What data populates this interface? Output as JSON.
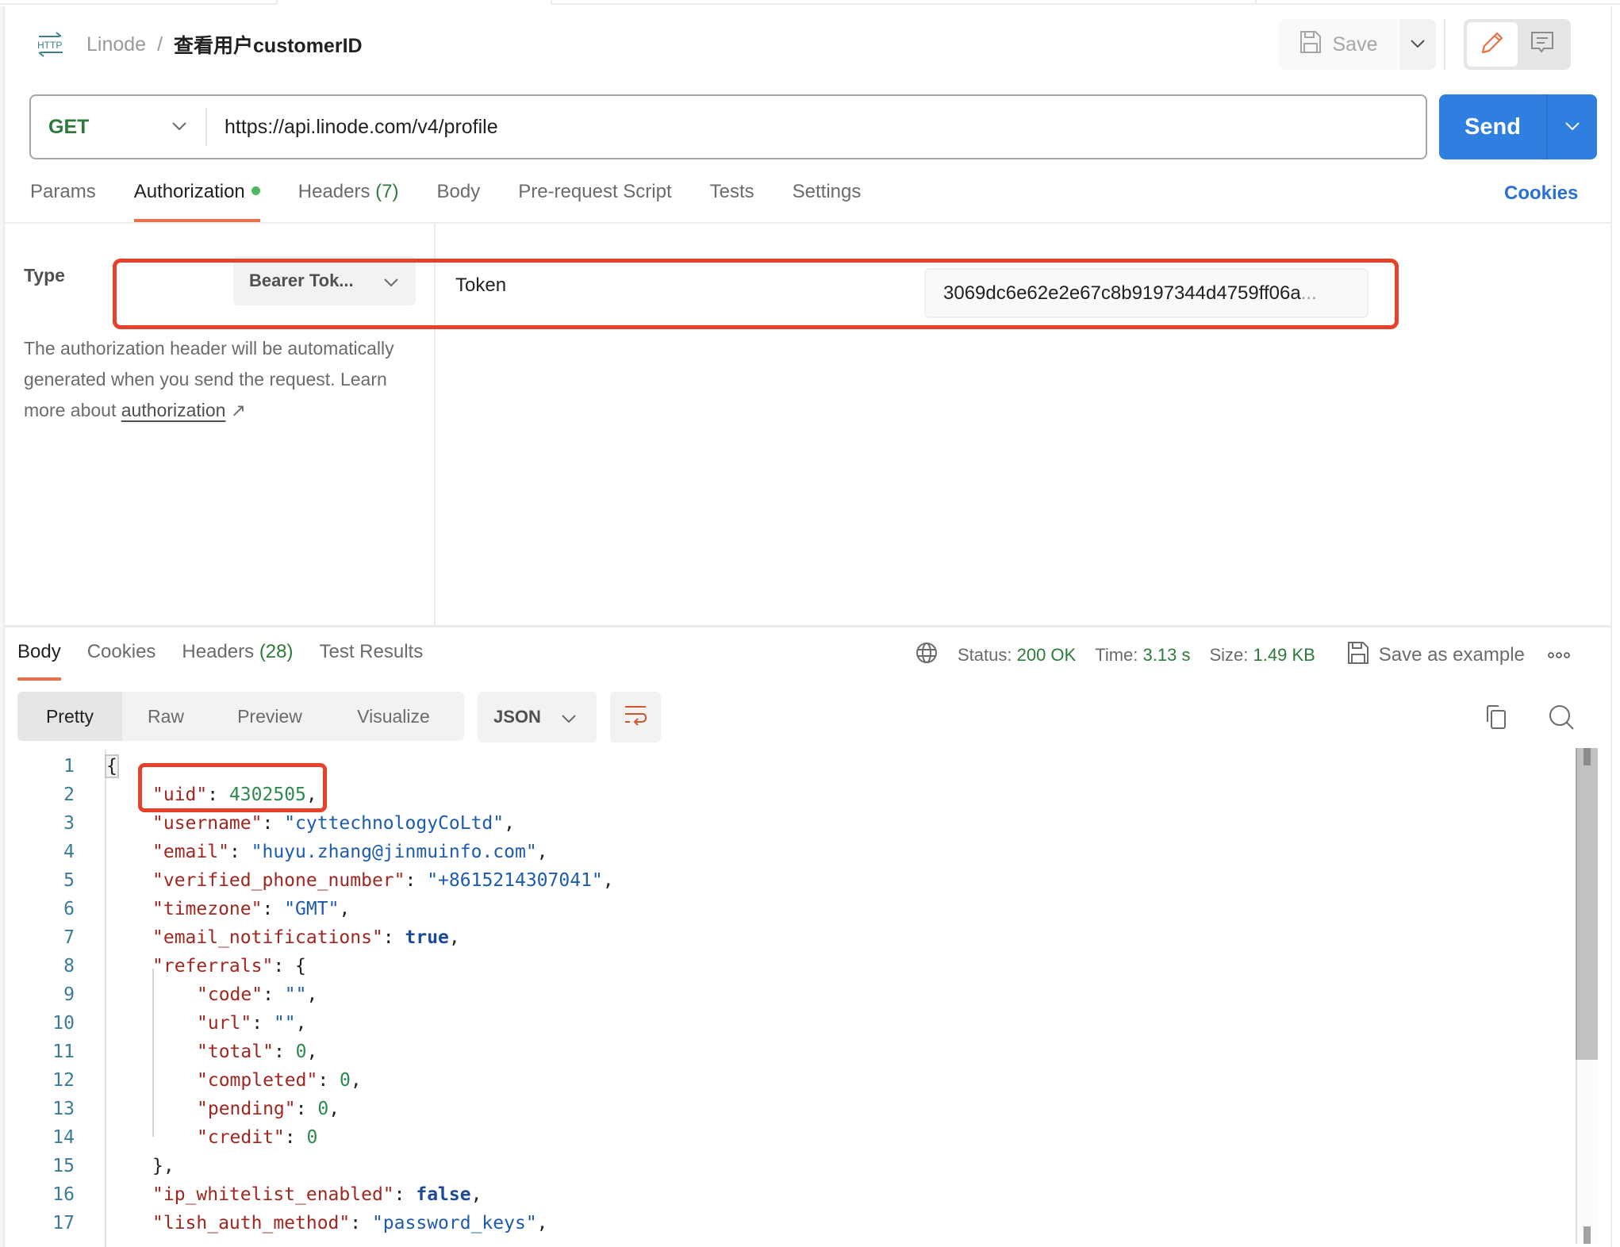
{
  "header": {
    "http_icon": "http-method-icon",
    "breadcrumb_parent": "Linode",
    "breadcrumb_separator": "/",
    "request_title": "查看用户customerID",
    "save_label": "Save",
    "save_icon": "floppy-disk-icon",
    "mode_edit_icon": "pencil-icon",
    "mode_comment_icon": "comment-icon"
  },
  "request": {
    "method": "GET",
    "method_color": "#2d7a3a",
    "url": "https://api.linode.com/v4/profile",
    "send_label": "Send",
    "send_color": "#2f7fe0"
  },
  "request_tabs": {
    "params": "Params",
    "authorization": "Authorization",
    "headers": "Headers",
    "headers_count": "(7)",
    "body": "Body",
    "pre_request_script": "Pre-request Script",
    "tests": "Tests",
    "settings": "Settings",
    "cookies": "Cookies",
    "active": "Authorization"
  },
  "auth": {
    "type_label": "Type",
    "type_value": "Bearer Tok...",
    "help_text": "The authorization header will be automatically generated when you send the request. Learn more about",
    "help_link": "authorization",
    "help_link_icon": "↗",
    "token_label": "Token",
    "token_value": "3069dc6e62e2e67c8b9197344d4759ff06a",
    "token_ellipsis": "..."
  },
  "response": {
    "tabs": {
      "body": "Body",
      "cookies": "Cookies",
      "headers": "Headers",
      "headers_count": "(28)",
      "test_results": "Test Results",
      "active": "Body"
    },
    "meta": {
      "status_label": "Status:",
      "status_value": "200 OK",
      "time_label": "Time:",
      "time_value": "3.13 s",
      "size_label": "Size:",
      "size_value": "1.49 KB",
      "save_example": "Save as example",
      "status_color": "#2d7a3a"
    },
    "view_modes": [
      "Pretty",
      "Raw",
      "Preview",
      "Visualize"
    ],
    "active_view": "Pretty",
    "format": "JSON",
    "code_lines": [
      {
        "n": "1",
        "parts": [
          [
            "p",
            "{"
          ]
        ]
      },
      {
        "n": "2",
        "parts": [
          [
            "k",
            "\"uid\""
          ],
          [
            "p",
            ": "
          ],
          [
            "n",
            "4302505"
          ],
          [
            "p",
            ","
          ]
        ]
      },
      {
        "n": "3",
        "parts": [
          [
            "k",
            "\"username\""
          ],
          [
            "p",
            ": "
          ],
          [
            "s",
            "\"cyttechnologyCoLtd\""
          ],
          [
            "p",
            ","
          ]
        ]
      },
      {
        "n": "4",
        "parts": [
          [
            "k",
            "\"email\""
          ],
          [
            "p",
            ": "
          ],
          [
            "s",
            "\"huyu.zhang@jinmuinfo.com\""
          ],
          [
            "p",
            ","
          ]
        ]
      },
      {
        "n": "5",
        "parts": [
          [
            "k",
            "\"verified_phone_number\""
          ],
          [
            "p",
            ": "
          ],
          [
            "s",
            "\"+8615214307041\""
          ],
          [
            "p",
            ","
          ]
        ]
      },
      {
        "n": "6",
        "parts": [
          [
            "k",
            "\"timezone\""
          ],
          [
            "p",
            ": "
          ],
          [
            "s",
            "\"GMT\""
          ],
          [
            "p",
            ","
          ]
        ]
      },
      {
        "n": "7",
        "parts": [
          [
            "k",
            "\"email_notifications\""
          ],
          [
            "p",
            ": "
          ],
          [
            "b",
            "true"
          ],
          [
            "p",
            ","
          ]
        ]
      },
      {
        "n": "8",
        "parts": [
          [
            "k",
            "\"referrals\""
          ],
          [
            "p",
            ": {"
          ]
        ]
      },
      {
        "n": "9",
        "indent": 2,
        "parts": [
          [
            "k",
            "\"code\""
          ],
          [
            "p",
            ": "
          ],
          [
            "s",
            "\"\""
          ],
          [
            "p",
            ","
          ]
        ]
      },
      {
        "n": "10",
        "indent": 2,
        "parts": [
          [
            "k",
            "\"url\""
          ],
          [
            "p",
            ": "
          ],
          [
            "s",
            "\"\""
          ],
          [
            "p",
            ","
          ]
        ]
      },
      {
        "n": "11",
        "indent": 2,
        "parts": [
          [
            "k",
            "\"total\""
          ],
          [
            "p",
            ": "
          ],
          [
            "n",
            "0"
          ],
          [
            "p",
            ","
          ]
        ]
      },
      {
        "n": "12",
        "indent": 2,
        "parts": [
          [
            "k",
            "\"completed\""
          ],
          [
            "p",
            ": "
          ],
          [
            "n",
            "0"
          ],
          [
            "p",
            ","
          ]
        ]
      },
      {
        "n": "13",
        "indent": 2,
        "parts": [
          [
            "k",
            "\"pending\""
          ],
          [
            "p",
            ": "
          ],
          [
            "n",
            "0"
          ],
          [
            "p",
            ","
          ]
        ]
      },
      {
        "n": "14",
        "indent": 2,
        "parts": [
          [
            "k",
            "\"credit\""
          ],
          [
            "p",
            ": "
          ],
          [
            "n",
            "0"
          ]
        ]
      },
      {
        "n": "15",
        "parts": [
          [
            "p",
            "},"
          ]
        ]
      },
      {
        "n": "16",
        "parts": [
          [
            "k",
            "\"ip_whitelist_enabled\""
          ],
          [
            "p",
            ": "
          ],
          [
            "b",
            "false"
          ],
          [
            "p",
            ","
          ]
        ]
      },
      {
        "n": "17",
        "parts": [
          [
            "k",
            "\"lish_auth_method\""
          ],
          [
            "p",
            ": "
          ],
          [
            "s",
            "\"password_keys\""
          ],
          [
            "p",
            ","
          ]
        ]
      }
    ]
  },
  "annotations": {
    "highlight_color": "#e8412a"
  }
}
